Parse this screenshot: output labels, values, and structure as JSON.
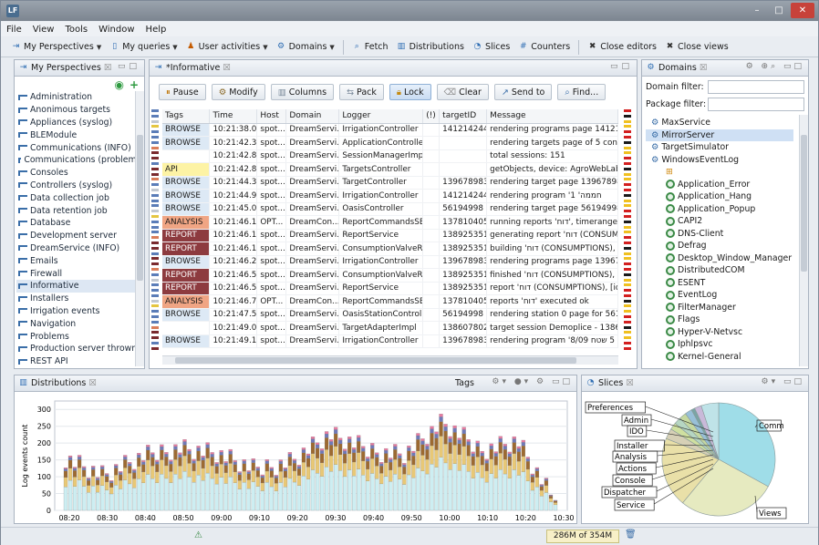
{
  "window": {
    "app_icon": "LF",
    "min": "–",
    "max": "□",
    "close": "✕"
  },
  "menu": [
    "File",
    "View",
    "Tools",
    "Window",
    "Help"
  ],
  "toolbar": [
    {
      "label": "My Perspectives",
      "icon": "perspective-icon",
      "dropdown": true
    },
    {
      "label": "My queries",
      "icon": "query-icon",
      "dropdown": true
    },
    {
      "label": "User activities",
      "icon": "users-icon",
      "dropdown": true
    },
    {
      "label": "Domains",
      "icon": "domains-icon",
      "dropdown": true
    },
    {
      "label": "Fetch",
      "icon": "fetch-icon",
      "dropdown": false
    },
    {
      "label": "Distributions",
      "icon": "distributions-icon",
      "dropdown": false
    },
    {
      "label": "Slices",
      "icon": "slices-icon",
      "dropdown": false
    },
    {
      "label": "Counters",
      "icon": "counters-icon",
      "dropdown": false
    },
    {
      "label": "Close editors",
      "icon": "close-editors-icon",
      "dropdown": false
    },
    {
      "label": "Close views",
      "icon": "close-views-icon",
      "dropdown": false
    }
  ],
  "perspectives": {
    "tab": "My Perspectives",
    "items": [
      "Administration",
      "Anonimous targets",
      "Appliances (syslog)",
      "BLEModule",
      "Communications (INFO)",
      "Communications (problems)",
      "Consoles",
      "Controllers (syslog)",
      "Data collection job",
      "Data retention job",
      "Database",
      "Development server",
      "DreamService (INFO)",
      "Emails",
      "Firewall",
      "Informative",
      "Installers",
      "Irrigation events",
      "Navigation",
      "Problems",
      "Production server thrown",
      "REST API"
    ],
    "selected": "Informative"
  },
  "informative": {
    "tab": "*Informative",
    "buttons": [
      "Pause",
      "Modify",
      "Columns",
      "Pack",
      "Lock",
      "Clear",
      "Send to",
      "Find..."
    ],
    "columns": [
      "Tags",
      "Time",
      "Host",
      "Domain",
      "Logger",
      "(!)",
      "targetID",
      "Message"
    ],
    "rows": [
      [
        "BROWSE",
        "10:21:38.009",
        "spot...",
        "DreamServi...",
        "IrrigationController",
        "",
        "1412142448",
        "rendering programs page 1412142448"
      ],
      [
        "BROWSE",
        "10:21:42.317",
        "spot...",
        "DreamServi...",
        "ApplicationController",
        "",
        "",
        "rendering targets page of 5 controllers"
      ],
      [
        "",
        "10:21:42.819",
        "spot...",
        "DreamServi...",
        "SessionManagerImpl",
        "",
        "",
        "total sessions: 151"
      ],
      [
        "API",
        "10:21:42.839",
        "spot...",
        "DreamServi...",
        "TargetsController",
        "",
        "",
        "getObjects, device: AgroWebLab test -"
      ],
      [
        "BROWSE",
        "10:21:44.302",
        "spot...",
        "DreamServi...",
        "TargetController",
        "",
        "1396789836",
        "rendering target page 1396789836 - נה"
      ],
      [
        "BROWSE",
        "10:21:44.942",
        "spot...",
        "DreamServi...",
        "IrrigationController",
        "",
        "1412142448",
        "rendering program '1 'חממה"
      ],
      [
        "BROWSE",
        "10:21:45.038",
        "spot...",
        "DreamServi...",
        "OasisController",
        "",
        "56194998",
        "rendering target page 56194998 - חוצב"
      ],
      [
        "ANALYSIS",
        "10:21:46.120",
        "OPT...",
        "DreamCon...",
        "ReportCommandsSE...",
        "",
        "1378104056",
        "running reports 'דוח', timerange: Asia"
      ],
      [
        "REPORT",
        "10:21:46.148",
        "spot...",
        "DreamServi...",
        "ReportService",
        "",
        "1389253511",
        "generating report 'דוח (CONSUMPTIC"
      ],
      [
        "REPORT",
        "10:21:46.149",
        "spot...",
        "DreamServi...",
        "ConsumptionValveR...",
        "",
        "1389253511",
        "building 'דוח (CONSUMPTIONS), [id="
      ],
      [
        "BROWSE",
        "10:21:46.234",
        "spot...",
        "DreamServi...",
        "IrrigationController",
        "",
        "1396789836",
        "rendering programs page 1396789836"
      ],
      [
        "REPORT",
        "10:21:46.530",
        "spot...",
        "DreamServi...",
        "ConsumptionValveR...",
        "",
        "1389253511",
        "finished 'דוח (CONSUMPTIONS), [id="
      ],
      [
        "REPORT",
        "10:21:46.530",
        "spot...",
        "DreamServi...",
        "ReportService",
        "",
        "1389253511",
        "report 'דוח (CONSUMPTIONS), [id=5:"
      ],
      [
        "ANALYSIS",
        "10:21:46.707",
        "OPT...",
        "DreamCon...",
        "ReportCommandsSE...",
        "",
        "1378104056",
        "reports 'דוח' executed ok"
      ],
      [
        "BROWSE",
        "10:21:47.557",
        "spot...",
        "DreamServi...",
        "OasisStationController",
        "",
        "56194998",
        "rendering station 0 page for 56194998"
      ],
      [
        "",
        "10:21:49.075",
        "spot...",
        "DreamServi...",
        "TargetAdapterImpl",
        "",
        "1386078020",
        "target session Demoplice - 1386078020"
      ],
      [
        "BROWSE",
        "10:21:49.108",
        "spot...",
        "DreamServi...",
        "IrrigationController",
        "",
        "1396789836",
        "rendering program '8/09 עדא 5 שטח"
      ]
    ]
  },
  "domains": {
    "tab": "Domains",
    "domain_filter_label": "Domain filter:",
    "package_filter_label": "Package filter:",
    "domain_filter_value": "",
    "package_filter_value": "",
    "tree": [
      {
        "label": "MaxService",
        "level": 0,
        "icon": "domain-icon"
      },
      {
        "label": "MirrorServer",
        "level": 0,
        "icon": "domain-icon",
        "selected": true
      },
      {
        "label": "TargetSimulator",
        "level": 0,
        "icon": "domain-icon"
      },
      {
        "label": "WindowsEventLog",
        "level": 0,
        "icon": "domain-icon"
      },
      {
        "label": "",
        "level": 1,
        "icon": "package-icon"
      },
      {
        "label": "Application_Error",
        "level": 1,
        "icon": "logger-icon"
      },
      {
        "label": "Application_Hang",
        "level": 1,
        "icon": "logger-icon"
      },
      {
        "label": "Application_Popup",
        "level": 1,
        "icon": "logger-icon"
      },
      {
        "label": "CAPI2",
        "level": 1,
        "icon": "logger-icon"
      },
      {
        "label": "DNS-Client",
        "level": 1,
        "icon": "logger-icon"
      },
      {
        "label": "Defrag",
        "level": 1,
        "icon": "logger-icon"
      },
      {
        "label": "Desktop_Window_Manager",
        "level": 1,
        "icon": "logger-icon"
      },
      {
        "label": "DistributedCOM",
        "level": 1,
        "icon": "logger-icon"
      },
      {
        "label": "ESENT",
        "level": 1,
        "icon": "logger-icon"
      },
      {
        "label": "EventLog",
        "level": 1,
        "icon": "logger-icon"
      },
      {
        "label": "FilterManager",
        "level": 1,
        "icon": "logger-icon"
      },
      {
        "label": "Flags",
        "level": 1,
        "icon": "logger-icon"
      },
      {
        "label": "Hyper-V-Netvsc",
        "level": 1,
        "icon": "logger-icon"
      },
      {
        "label": "Iphlpsvc",
        "level": 1,
        "icon": "logger-icon"
      },
      {
        "label": "Kernel-General",
        "level": 1,
        "icon": "logger-icon"
      }
    ]
  },
  "distributions": {
    "tab": "Distributions",
    "mode": "Tags",
    "ylabel": "Log events count",
    "yticks": [
      0,
      50,
      100,
      150,
      200,
      250,
      300
    ],
    "xticks": [
      "08:20",
      "08:30",
      "08:40",
      "08:50",
      "09:00",
      "09:10",
      "09:20",
      "09:30",
      "09:40",
      "09:50",
      "10:00",
      "10:10",
      "10:20",
      "10:30"
    ],
    "colors": {
      "base": "#cdeef2",
      "mid": "#e8c876",
      "top": "#9c6a32",
      "accent": "#6f79b8",
      "pink": "#e87aa0"
    }
  },
  "chart_data": {
    "type": "bar",
    "ylabel": "Log events count",
    "ylim": [
      0,
      325
    ],
    "x": [
      "08:20",
      "08:30",
      "08:40",
      "08:50",
      "09:00",
      "09:10",
      "09:20",
      "09:30",
      "09:40",
      "09:50",
      "10:00",
      "10:10",
      "10:20",
      "10:30"
    ],
    "values": [
      160,
      105,
      155,
      190,
      170,
      120,
      150,
      225,
      180,
      170,
      260,
      180,
      210,
      20
    ],
    "grid": true
  },
  "slices": {
    "tab": "Slices",
    "labels": [
      "Preferences",
      "Admin",
      "IDO",
      "Installer",
      "Analysis",
      "Actions",
      "Console",
      "Dispatcher",
      "Service",
      "Comm",
      "Views"
    ]
  },
  "slices_chart": {
    "type": "pie",
    "categories": [
      "Comm",
      "Views",
      "Service",
      "Dispatcher",
      "Console",
      "Actions",
      "Analysis",
      "Installer",
      "IDO",
      "Admin",
      "Preferences"
    ],
    "values": [
      33,
      28,
      20,
      3,
      2,
      2,
      2,
      2,
      1,
      2,
      5
    ],
    "colors": [
      "#9fdde8",
      "#e6eac0",
      "#e9e0a8",
      "#d6d0b6",
      "#cfe0a0",
      "#b6d6c2",
      "#c5d8a0",
      "#98c0d8",
      "#7aa5a5",
      "#c9b9d9",
      "#bfe3e8"
    ]
  },
  "status": {
    "memory": "286M of 354M"
  }
}
